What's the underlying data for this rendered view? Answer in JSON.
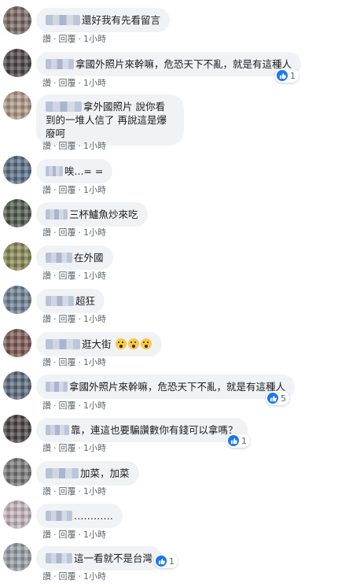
{
  "actions": {
    "like": "讚",
    "reply": "回覆",
    "time": "1小時",
    "dot": "·"
  },
  "colors": {
    "bubble": "#f0f2f5",
    "like_blue": "#1877f2",
    "meta_gray": "#606770"
  },
  "comments": [
    {
      "text": "還好我有先看留言",
      "avatar_color": "#7a6a66"
    },
    {
      "text": "拿國外照片來幹嘛，危恐天下不亂，就是有這種人",
      "avatar_color": "#4e4548",
      "likes": "1"
    },
    {
      "text": "拿外國照片 說你看到的一堆人信了 再說這是爆廢呵",
      "avatar_color": "#b09a86"
    },
    {
      "text": "唉...= =",
      "avatar_color": "#5a6f86"
    },
    {
      "text": "三杯鱸魚炒來吃",
      "avatar_color": "#4f5a4e"
    },
    {
      "text": "在外國",
      "avatar_color": "#8a8a55"
    },
    {
      "text": "超狂",
      "avatar_color": "#6f8396"
    },
    {
      "text": "逛大街",
      "avatar_color": "#7e5a52"
    },
    {
      "text": "拿國外照片來幹嘛，危恐天下不亂，就是有這種人",
      "avatar_color": "#5c6b7e",
      "likes": "5"
    },
    {
      "text": "靠，連這也要騙讚數你有錢可以拿嗎？",
      "avatar_color": "#4d4446",
      "likes": "1"
    },
    {
      "text": "加菜，加菜",
      "avatar_color": "#7a7a7a"
    },
    {
      "text": "…………",
      "avatar_color": "#c7b8bf"
    },
    {
      "text": "這一看就不是台灣",
      "avatar_color": "#9aa0a8",
      "likes": "1"
    }
  ]
}
